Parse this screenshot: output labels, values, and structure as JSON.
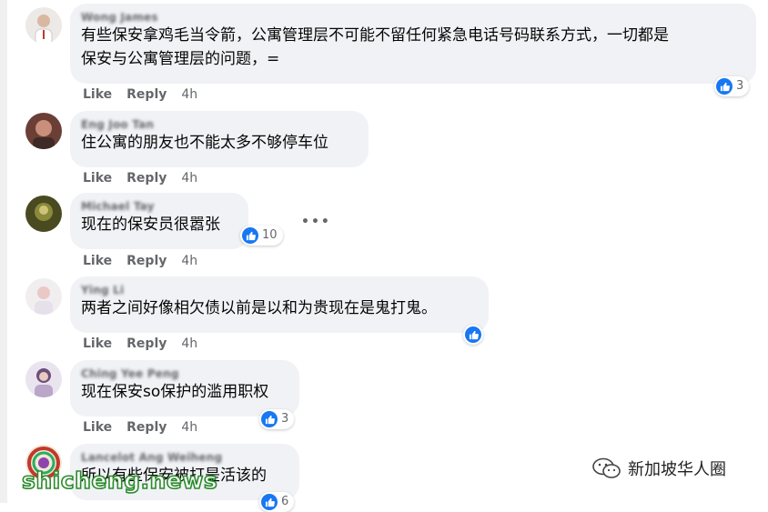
{
  "actions": {
    "like": "Like",
    "reply": "Reply"
  },
  "comments": [
    {
      "author": "Wong James",
      "text": "有些保安拿鸡毛当令箭，公寓管理层不可能不留任何紧急电话号码联系方式，一切都是\n保安与公寓管理层的问题，=",
      "time": "4h",
      "reactions": "3"
    },
    {
      "author": "Eng Joo Tan",
      "text": "住公寓的朋友也不能太多不够停车位",
      "time": "4h",
      "reactions": ""
    },
    {
      "author": "Michael Tay",
      "text": "现在的保安员很嚣张",
      "time": "4h",
      "reactions": "10"
    },
    {
      "author": "Ying Li",
      "text": "两者之间好像相欠债以前是以和为贵现在是鬼打鬼。",
      "time": "4h",
      "reactions": ""
    },
    {
      "author": "Ching Yee Peng",
      "text": "现在保安so保护的滥用职权",
      "time": "4h",
      "reactions": "3"
    },
    {
      "author": "Lancelot Ang Weiheng",
      "text": "所以有些保安被打是活该的",
      "time": "",
      "reactions": "6"
    }
  ],
  "watermark": "shicheng.news",
  "wechat_name": "新加坡华人圈",
  "icons": {
    "like": "like-icon",
    "more": "more-options-icon",
    "wechat": "wechat-icon"
  },
  "colors": {
    "like_blue": "#1877f2",
    "bubble": "#f0f2f5",
    "meta": "#65676b"
  }
}
